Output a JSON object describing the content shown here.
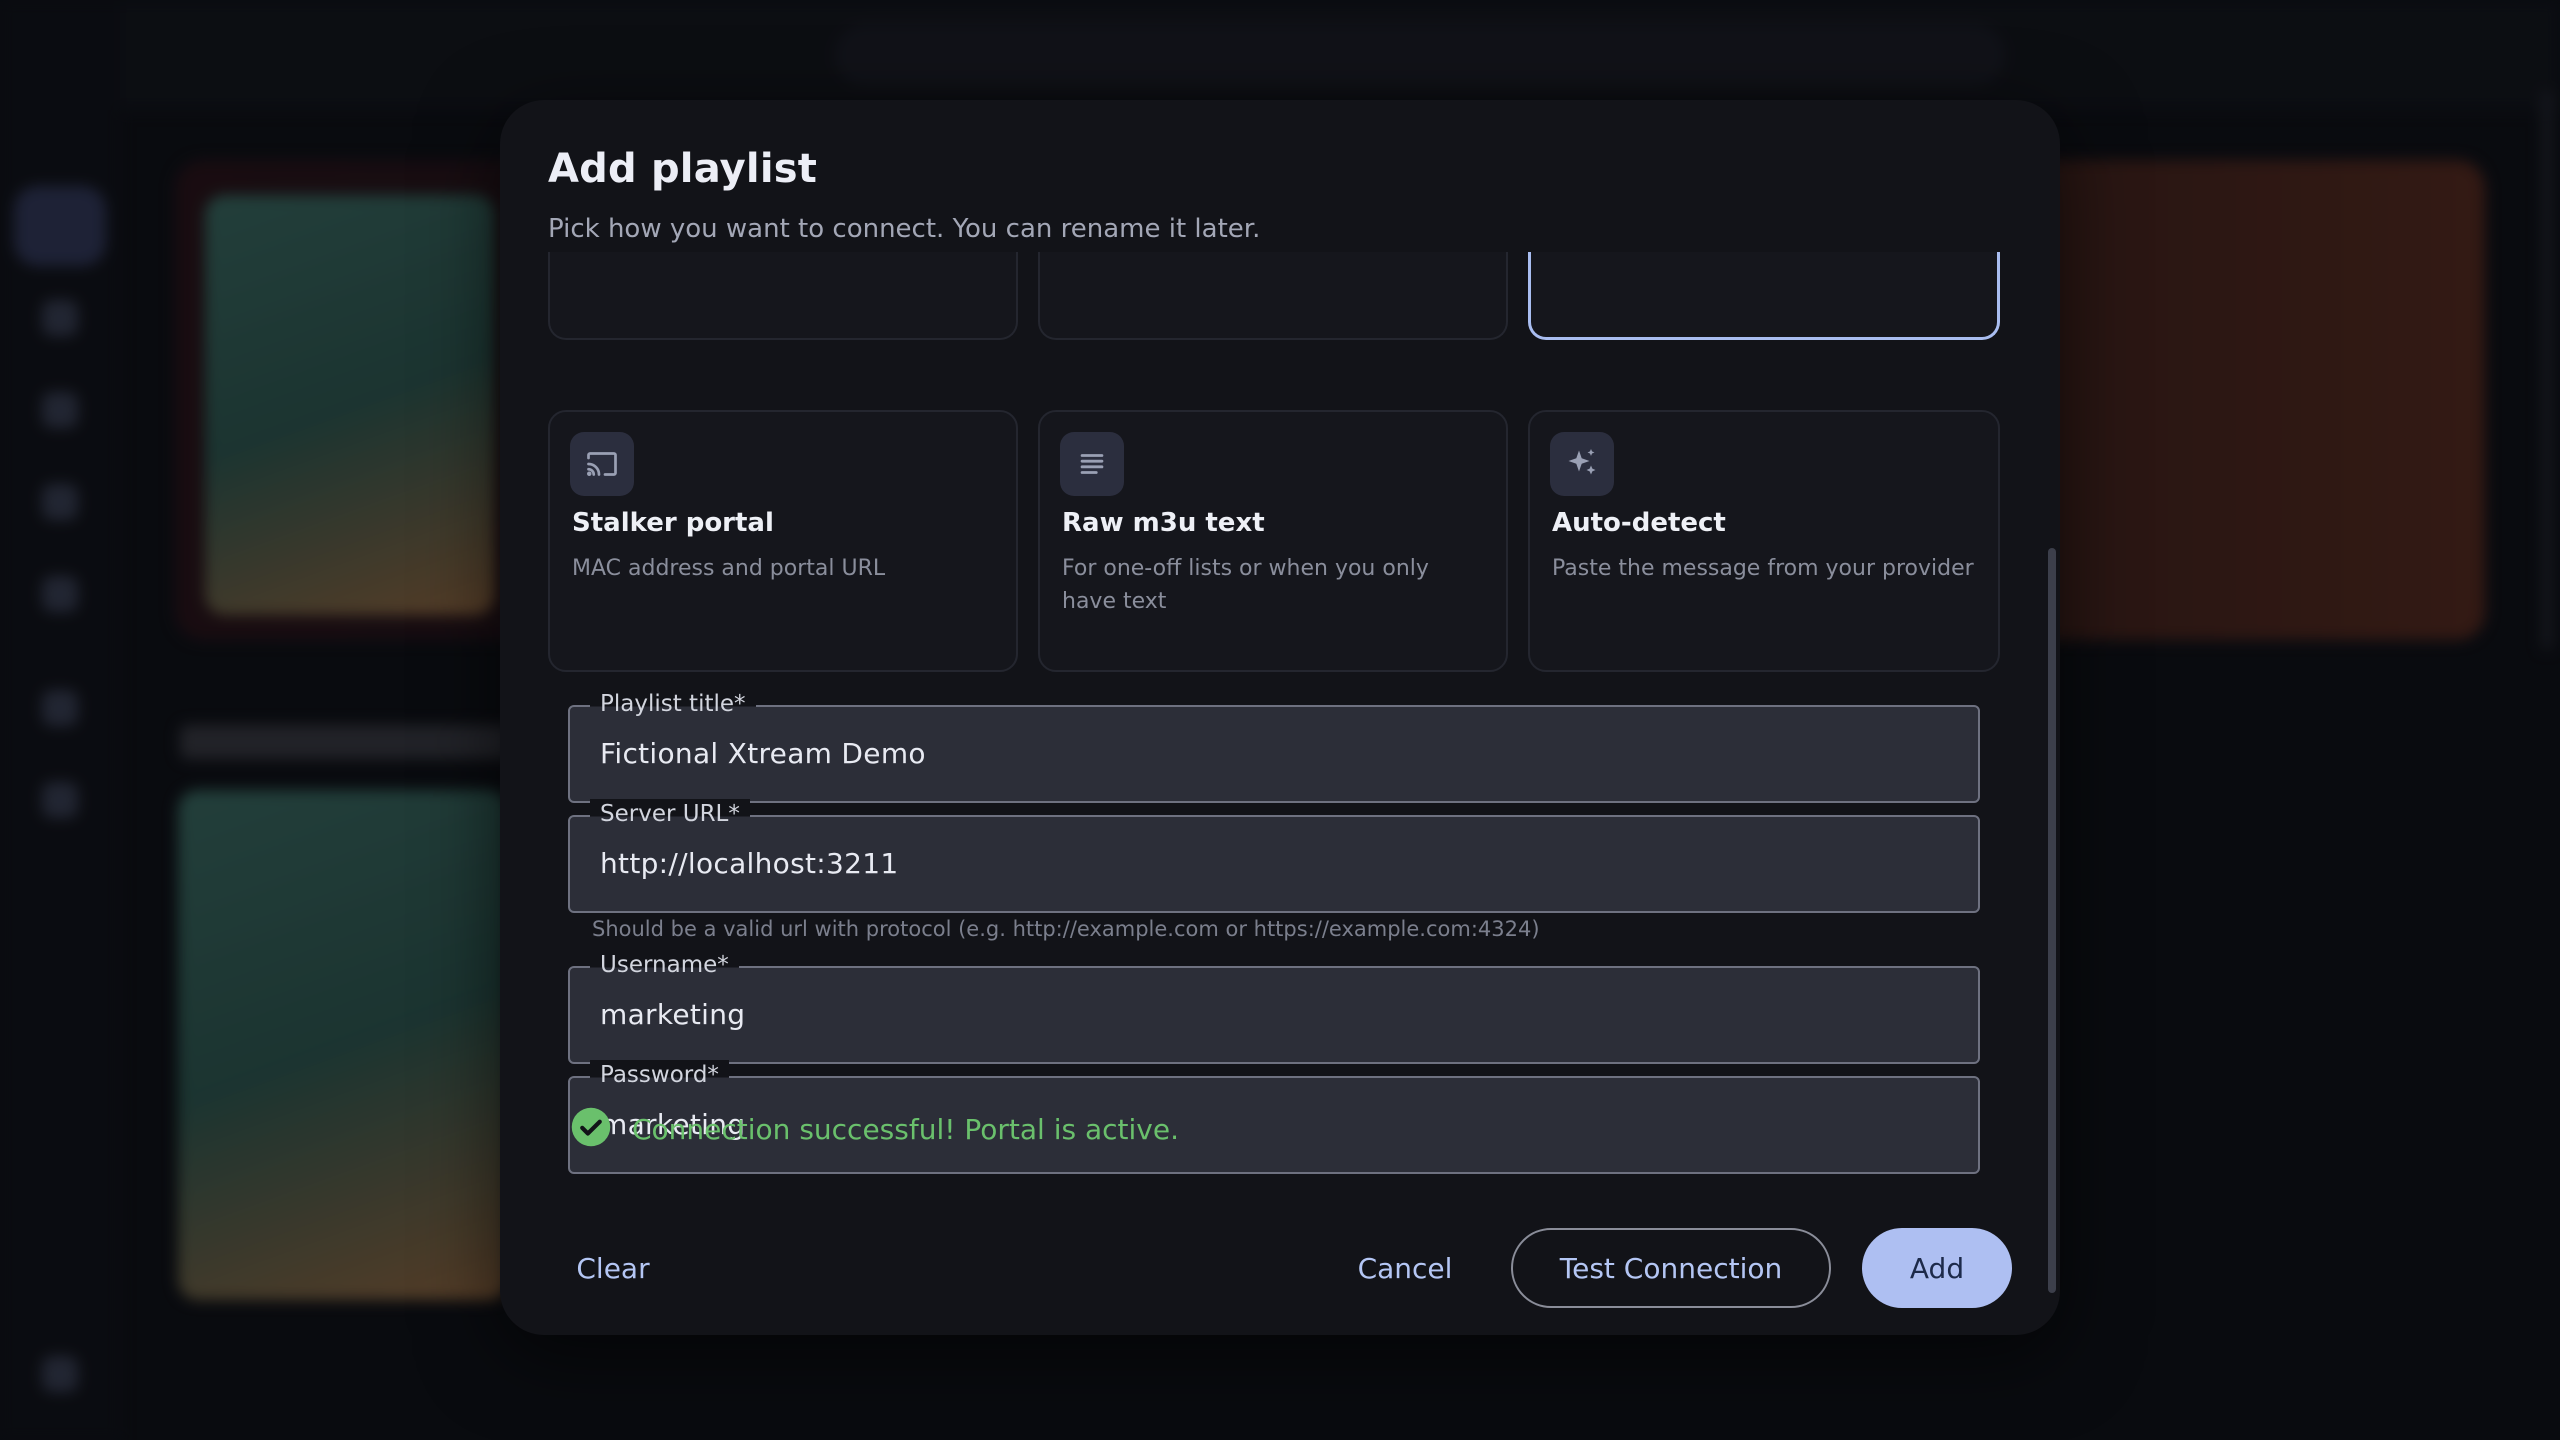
{
  "dialog": {
    "title": "Add playlist",
    "subtitle": "Pick how you want to connect. You can rename it later."
  },
  "options": [
    {
      "title": "Stalker portal",
      "description": "MAC address and portal URL",
      "icon": "cast-icon"
    },
    {
      "title": "Raw m3u text",
      "description": "For one-off lists or when you only have text",
      "icon": "text-lines-icon"
    },
    {
      "title": "Auto-detect",
      "description": "Paste the message from your provider",
      "icon": "sparkles-icon"
    }
  ],
  "form": {
    "playlist_title": {
      "label": "Playlist title*",
      "value": "Fictional Xtream Demo"
    },
    "server_url": {
      "label": "Server URL*",
      "value": "http://localhost:3211",
      "hint": "Should be a valid url with protocol (e.g. http://example.com or https://example.com:4324)"
    },
    "username": {
      "label": "Username*",
      "value": "marketing"
    },
    "password": {
      "label": "Password*",
      "value": "marketing"
    }
  },
  "status": {
    "text": "Connection successful! Portal is active.",
    "color": "#6ac06c"
  },
  "buttons": {
    "clear": "Clear",
    "cancel": "Cancel",
    "test": "Test Connection",
    "add": "Add"
  },
  "colors": {
    "accent": "#aebff2",
    "dialog_bg": "#121318",
    "success": "#6ac06c"
  }
}
